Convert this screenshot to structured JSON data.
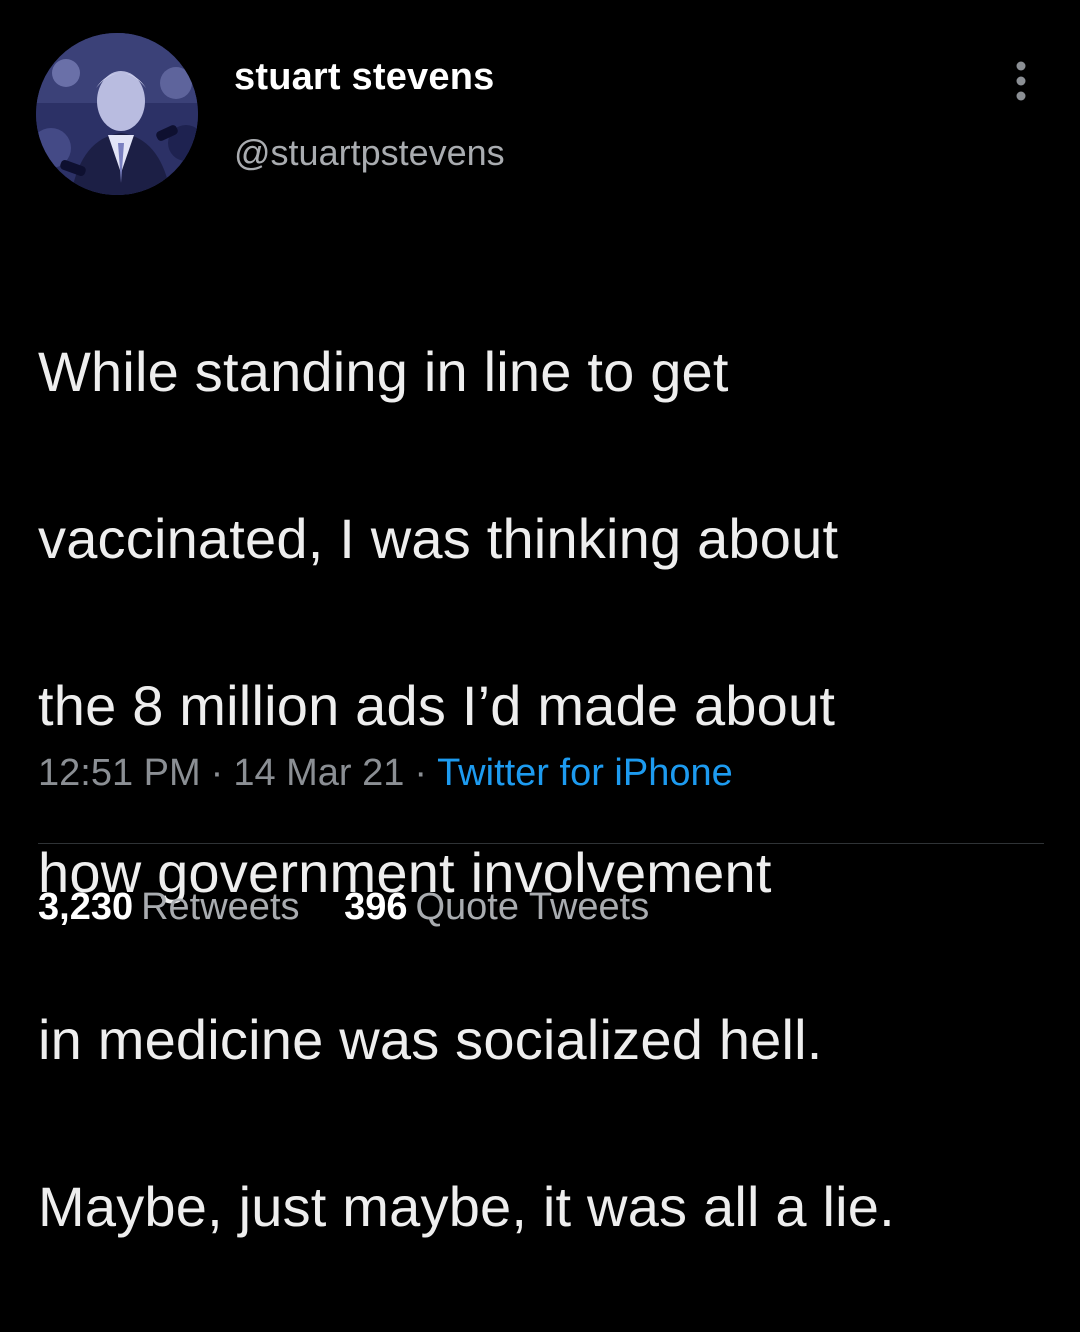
{
  "tweet": {
    "author": {
      "display_name": "stuart stevens",
      "handle": "@stuartpstevens"
    },
    "text_lines": [
      "While standing in line to get",
      "vaccinated, I was thinking about",
      "the 8 million ads I’d made about",
      "how government involvement",
      "in medicine was socialized hell.",
      "Maybe, just maybe, it was all a lie."
    ],
    "time": "12:51 PM",
    "date": "14 Mar 21",
    "separator": "·",
    "source": "Twitter for iPhone",
    "stats": {
      "retweets_count": "3,230",
      "retweets_label": "Retweets",
      "quotes_count": "396",
      "quotes_label": "Quote Tweets"
    }
  },
  "icons": {
    "more_menu": "more-vertical-icon"
  },
  "colors": {
    "background": "#000000",
    "link": "#1d9bf0",
    "muted": "#8b8f94"
  }
}
